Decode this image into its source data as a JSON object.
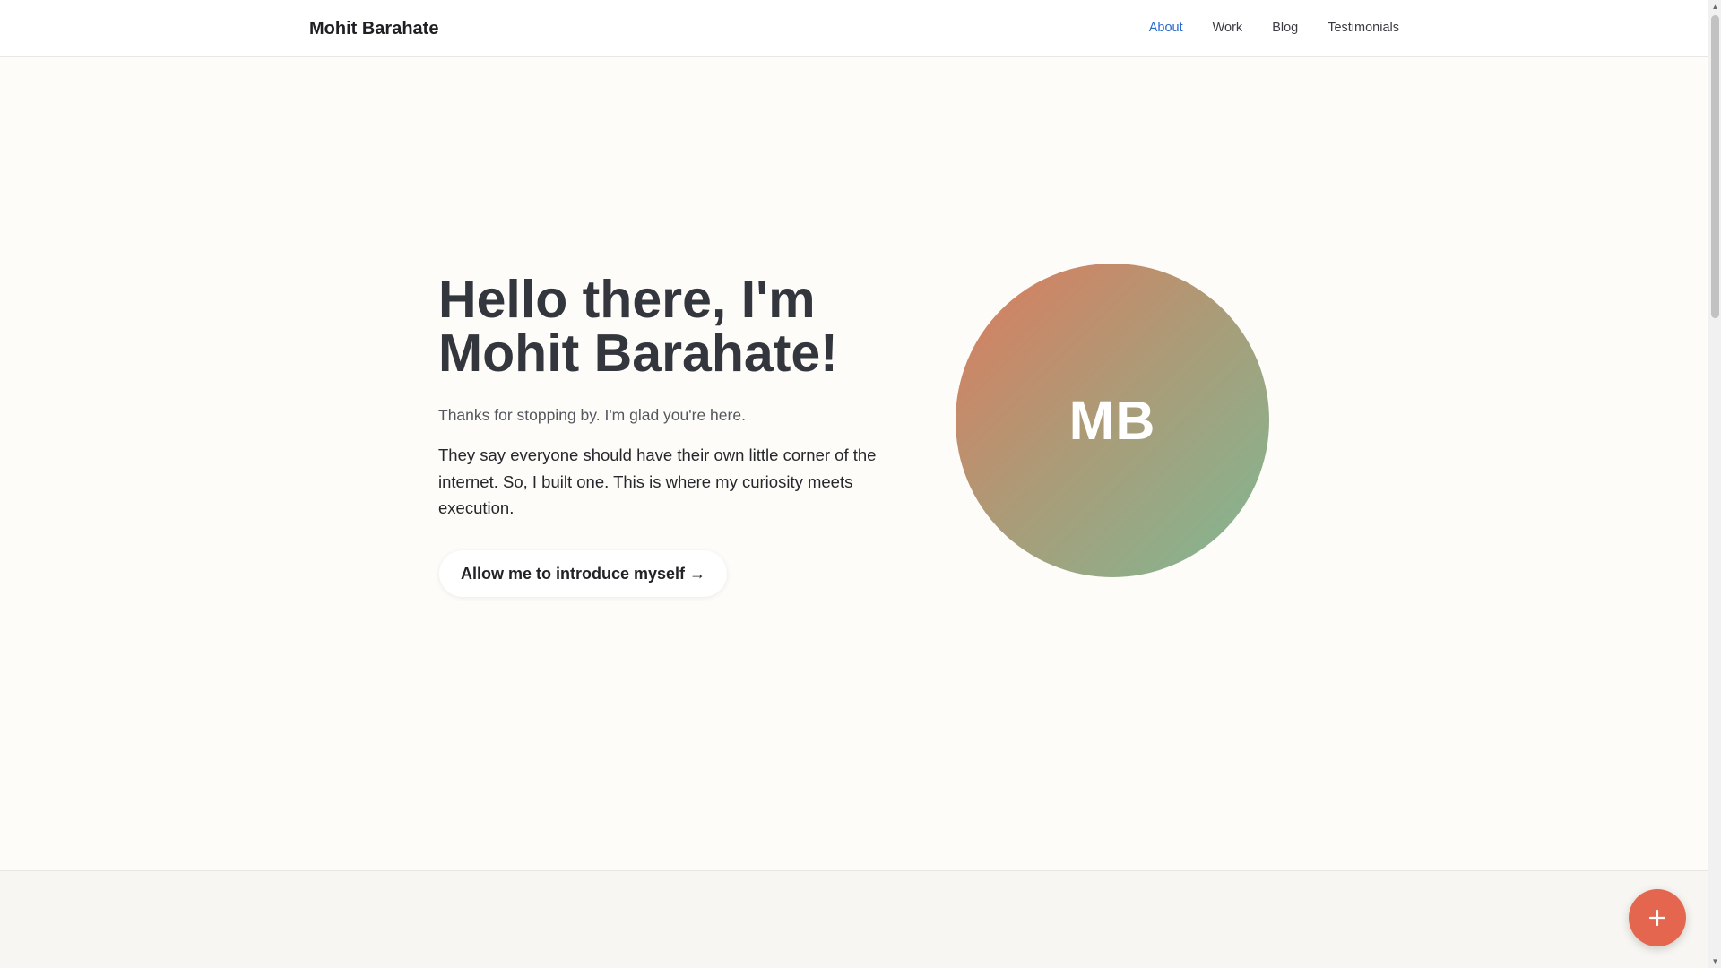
{
  "header": {
    "brand": "Mohit Barahate",
    "nav": [
      {
        "label": "About",
        "active": true
      },
      {
        "label": "Work",
        "active": false
      },
      {
        "label": "Blog",
        "active": false
      },
      {
        "label": "Testimonials",
        "active": false
      }
    ]
  },
  "hero": {
    "title_line1": "Hello there, I'm",
    "title_line2": "Mohit Barahate!",
    "subtitle": "Thanks for stopping by. I'm glad you're here.",
    "body": "They say everyone should have their own little corner of the internet. So, I built one. This is where my curiosity meets execution.",
    "cta_label": "Allow me to introduce myself →",
    "avatar_initials": "MB"
  },
  "fab": {
    "icon": "plus-icon"
  },
  "colors": {
    "accent_link": "#2a6acb",
    "fab": "#e4664f",
    "avatar_gradient_start": "#dc7c5e",
    "avatar_gradient_end": "#80b894",
    "page_background": "#fdfcf8"
  },
  "scrollbar": {
    "up_arrow": "▲",
    "down_arrow": "▼"
  }
}
